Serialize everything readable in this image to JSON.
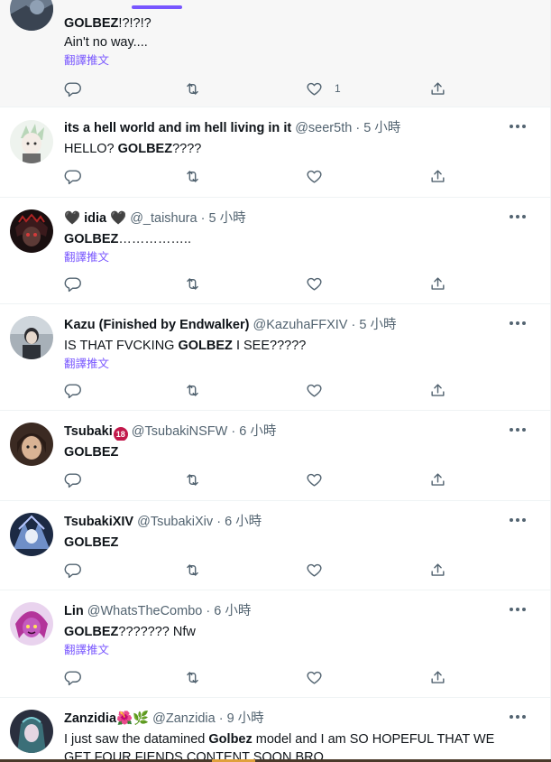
{
  "colors": {
    "accent": "#7856ff",
    "text": "#0f1419",
    "secondary": "#536471",
    "divider": "#eff3f4"
  },
  "ui": {
    "translate_label": "翻譯推文",
    "more_icon": "more-horizontal-icon"
  },
  "tweets": [
    {
      "id": "t0",
      "name": "",
      "handle": "",
      "time": "",
      "body_bold": "GOLBEZ",
      "body_after": "!?!?!?",
      "body2": "Ain't no way....",
      "translate": true,
      "like_count": "1"
    },
    {
      "id": "t1",
      "name": "its a hell world and im hell living in it",
      "handle": "@seer5th",
      "sep": "·",
      "time": "5 小時",
      "body_before": "HELLO? ",
      "body_bold": "GOLBEZ",
      "body_after": "????",
      "translate": false
    },
    {
      "id": "t2",
      "name_pre": "🖤",
      "name": "idia",
      "name_post": "🖤",
      "handle": "@_taishura",
      "sep": "·",
      "time": "5 小時",
      "body_bold": "GOLBEZ",
      "body_after": "……………..",
      "translate": true
    },
    {
      "id": "t3",
      "name": "Kazu (Finished by Endwalker)",
      "handle": "@KazuhaFFXIV",
      "sep": "·",
      "time": "5 小時",
      "body_before": "IS THAT FVCKING ",
      "body_bold": "GOLBEZ",
      "body_after": " I SEE?????",
      "translate": true
    },
    {
      "id": "t4",
      "name": "Tsubaki",
      "badge": "18",
      "handle": "@TsubakiNSFW",
      "sep": "·",
      "time": "6 小時",
      "body_bold": "GOLBEZ",
      "body_after": "",
      "translate": false
    },
    {
      "id": "t5",
      "name": "TsubakiXIV",
      "handle": "@TsubakiXiv",
      "sep": "·",
      "time": "6 小時",
      "body_bold": "GOLBEZ",
      "body_after": "",
      "translate": false
    },
    {
      "id": "t6",
      "name": "Lin",
      "handle": "@WhatsTheCombo",
      "sep": "·",
      "time": "6 小時",
      "body_bold": "GOLBEZ",
      "body_after": "??????? Nfw",
      "translate": true
    },
    {
      "id": "t7",
      "name": "Zanzidia",
      "name_emoji": "🌺🌿",
      "handle": "@Zanzidia",
      "sep": "·",
      "time": "9 小時",
      "body_before": "I just saw the datamined ",
      "body_bold": "Golbez",
      "body_after": " model and I am SO HOPEFUL THAT WE",
      "body2": "GET FOUR FIENDS CONTENT SOON BRO",
      "translate": false
    }
  ]
}
